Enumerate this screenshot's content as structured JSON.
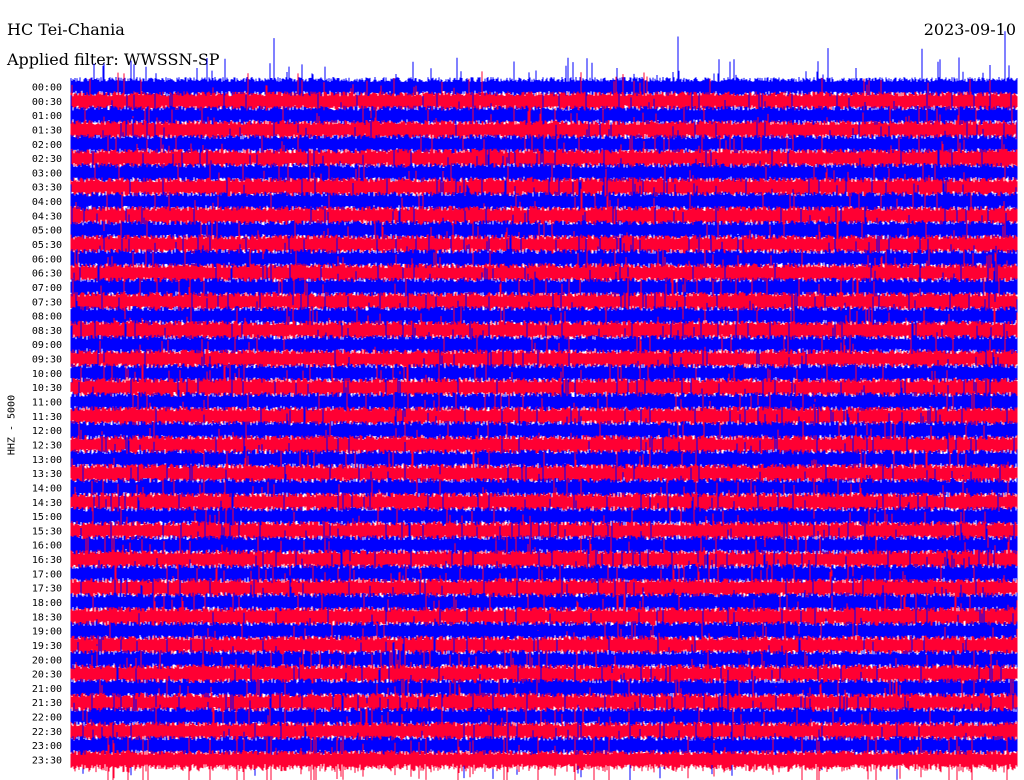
{
  "header": {
    "station": "HC Tei-Chania",
    "filter": "Applied filter: WWSSN-SP",
    "date": "2023-09-10",
    "channel": "HHZ - 5000"
  },
  "colors": {
    "trace_a": "#0000ff",
    "trace_b": "#ff0033",
    "background": "#ffffff",
    "text": "#000000"
  },
  "chart_data": {
    "type": "line",
    "title": "",
    "rows": [
      "00:00",
      "00:30",
      "01:00",
      "01:30",
      "02:00",
      "02:30",
      "03:00",
      "03:30",
      "04:00",
      "04:30",
      "05:00",
      "05:30",
      "06:00",
      "06:30",
      "07:00",
      "07:30",
      "08:00",
      "08:30",
      "09:00",
      "09:30",
      "10:00",
      "10:30",
      "11:00",
      "11:30",
      "12:00",
      "12:30",
      "13:00",
      "13:30",
      "14:00",
      "14:30",
      "15:00",
      "15:30",
      "16:00",
      "16:30",
      "17:00",
      "17:30",
      "18:00",
      "18:30",
      "19:00",
      "19:30",
      "20:00",
      "20:30",
      "21:00",
      "21:30",
      "22:00",
      "22:30",
      "23:00",
      "23:30"
    ],
    "row_colors": [
      "trace_a",
      "trace_b"
    ],
    "ylabel": "HHZ - 5000",
    "grid": false,
    "legend": "none"
  }
}
